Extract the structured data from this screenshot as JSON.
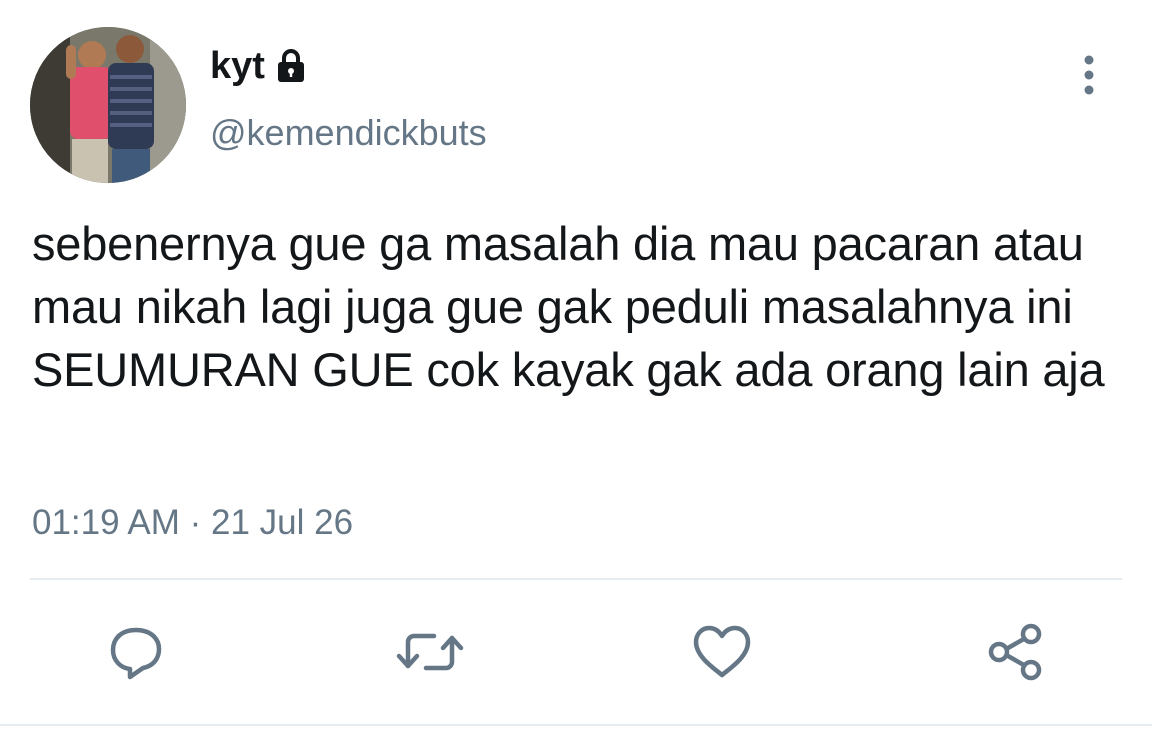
{
  "tweet": {
    "display_name": "kyt",
    "handle": "@kemendickbuts",
    "protected_icon": "lock-icon",
    "text": "sebenernya gue ga masalah dia mau pacaran atau mau nikah lagi juga gue gak peduli masalahnya ini SEUMURAN GUE cok kayak gak ada orang lain aja",
    "timestamp": "01:19 AM · 21 Jul 26"
  },
  "actions": [
    {
      "name": "reply",
      "icon": "reply-icon"
    },
    {
      "name": "retweet",
      "icon": "retweet-icon"
    },
    {
      "name": "like",
      "icon": "heart-icon"
    },
    {
      "name": "share",
      "icon": "share-icon"
    }
  ],
  "colors": {
    "text_primary": "#14171a",
    "text_secondary": "#657786",
    "divider": "#e6ecf0",
    "icon": "#657786"
  }
}
